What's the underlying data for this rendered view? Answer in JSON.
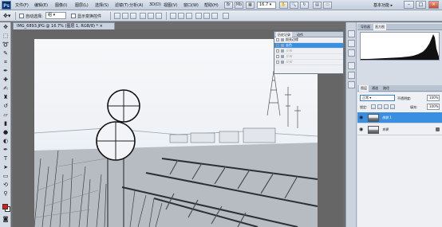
{
  "app": {
    "logo": "Ps"
  },
  "menu": [
    "文件(F)",
    "编辑(E)",
    "图像(I)",
    "图层(L)",
    "选择(S)",
    "滤镜(T)",
    "分析(A)",
    "3D(D)",
    "视图(V)",
    "窗口(W)",
    "帮助(H)"
  ],
  "titlebar": {
    "zoom": "16.7",
    "workspace": "基本功能"
  },
  "options": {
    "auto_select_label": "自动选择:",
    "auto_select_value": "组",
    "transform_label": "显示变换控件"
  },
  "document": {
    "tab_title": "IMG_6893.JPG @ 16.7% (图层 1, RGB/8) *"
  },
  "history": {
    "tabs": [
      "历史记录",
      "动作"
    ],
    "items": [
      {
        "label": "照亮边缘",
        "state": "normal"
      },
      {
        "label": "去色",
        "state": "selected"
      },
      {
        "label": "反相",
        "state": "dim"
      },
      {
        "label": "反相",
        "state": "dim"
      },
      {
        "label": "反相",
        "state": "dim"
      }
    ]
  },
  "histogram_panel": {
    "tabs": [
      "导航器",
      "直方图"
    ]
  },
  "layers_panel": {
    "tabs": [
      "图层",
      "通道",
      "路径"
    ],
    "blend_mode": "正常",
    "opacity_label": "不透明度:",
    "opacity": "100%",
    "lock_label": "锁定:",
    "fill_label": "填充:",
    "fill": "100%",
    "layers": [
      {
        "name": "图层 1",
        "selected": true
      },
      {
        "name": "背景",
        "selected": false
      }
    ]
  },
  "colors": {
    "foreground": "#e41a1a",
    "background": "#ffffff",
    "selection": "#3a8fe0"
  }
}
